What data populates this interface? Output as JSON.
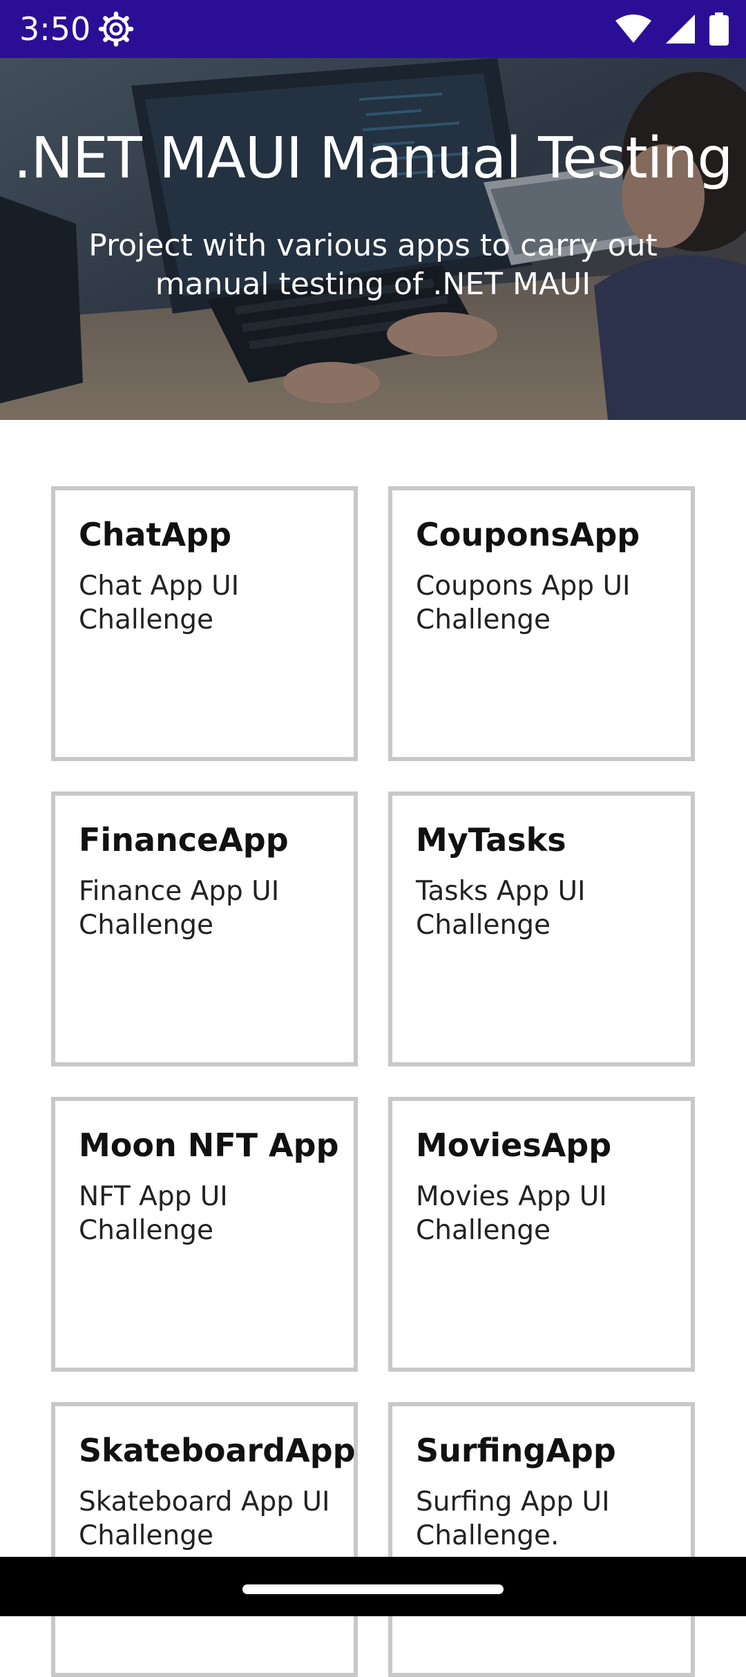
{
  "status_bar": {
    "time": "3:50",
    "icons": [
      "settings-gear-icon",
      "wifi-icon",
      "signal-icon",
      "battery-icon"
    ],
    "background": "#2a0f96"
  },
  "hero": {
    "title": ".NET MAUI Manual Testing",
    "subtitle": "Project with various apps to carry out manual testing of .NET MAUI"
  },
  "apps": [
    {
      "title": "ChatApp",
      "description": "Chat App UI Challenge"
    },
    {
      "title": "CouponsApp",
      "description": "Coupons App UI Challenge"
    },
    {
      "title": "FinanceApp",
      "description": "Finance App UI Challenge"
    },
    {
      "title": "MyTasks",
      "description": "Tasks App UI Challenge"
    },
    {
      "title": "Moon NFT App",
      "description": "NFT App UI Challenge"
    },
    {
      "title": "MoviesApp",
      "description": "Movies App UI Challenge"
    },
    {
      "title": "SkateboardApp",
      "description": "Skateboard App UI Challenge"
    },
    {
      "title": "SurfingApp",
      "description": "Surfing App UI Challenge."
    }
  ],
  "colors": {
    "card_border": "#c8c8c8",
    "nav_bar": "#000000"
  }
}
